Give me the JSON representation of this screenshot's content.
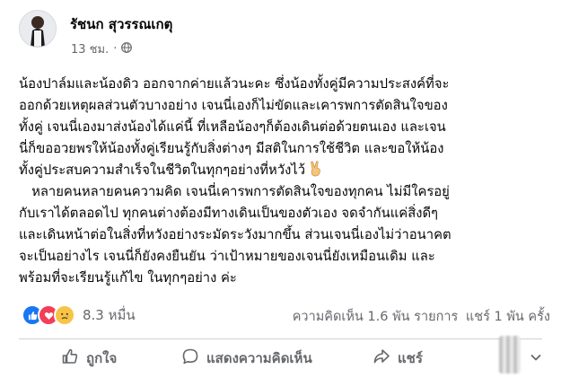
{
  "author": {
    "name": "รัชนก สุวรรณเกตุ"
  },
  "post": {
    "time": "13 ชม.",
    "paragraph1": [
      "น้องปาล์มและน้องดิว ออกจากค่ายแล้วนะคะ ซึ่งน้องทั้งคู่มีความประสงค์ที่จะ",
      "ออกด้วยเหตุผลส่วนตัวบางอย่าง เจนนี่เองก็ไม่ขัดและเคารพการตัดสินใจของ",
      "ทั้งคู่ เจนนี่เองมาส่งน้องได้แค่นี้ ที่เหลือน้องๆก็ต้องเดินต่อด้วยตนเอง และเจน",
      "นี่ก็ขออวยพรให้น้องทั้งคู่เรียนรู้กับสิ่งต่างๆ มีสติในการใช้ชีวิต และขอให้น้อง",
      "ทั้งคู่ประสบความสำเร็จในชีวิตในทุกๆอย่างที่หวังไว้"
    ],
    "paragraph2": [
      "   หลายคนหลายคนความคิด เจนนี่เคารพการตัดสินใจของทุกคน ไม่มีใครอยู่",
      "กับเราได้ตลอดไป ทุกคนต่างต้องมีทางเดินเป็นของตัวเอง จดจำกันแค่สิ่งดีๆ",
      "และเดินหน้าต่อในสิ่งที่หวังอย่างระมัดระวังมากขึ้น ส่วนเจนนี่เองไม่ว่าอนาคต",
      "จะเป็นอย่างไร เจนนี่ก็ยังคงยืนยัน ว่าเป้าหมายของเจนนี่ยังเหมือนเดิม และ",
      "พร้อมที่จะเรียนรู้แก้ไข ในทุกๆอย่าง ค่ะ"
    ]
  },
  "reactions": {
    "count": "8.3 หมื่น"
  },
  "stats": {
    "comments": "ความคิดเห็น 1.6 พัน รายการ",
    "shares": "แชร์ 1 พัน ครั้ง"
  },
  "actions": {
    "like": "ถูกใจ",
    "comment": "แสดงความคิดเห็น",
    "share": "แชร์"
  },
  "colors": {
    "like_blue": "#1877f2",
    "love_red": "#f33e58",
    "secondary_text": "#65676b"
  }
}
